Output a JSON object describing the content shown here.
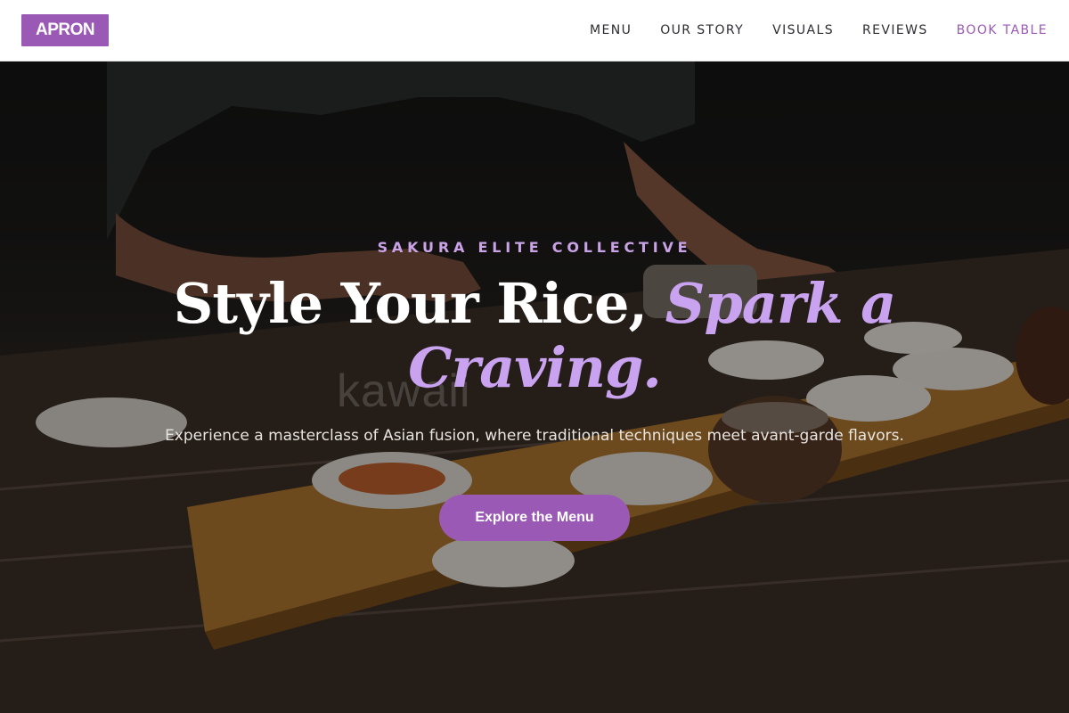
{
  "header": {
    "logo": "APRON",
    "nav": [
      {
        "label": "MENU"
      },
      {
        "label": "OUR STORY"
      },
      {
        "label": "VISUALS"
      },
      {
        "label": "REVIEWS"
      },
      {
        "label": "BOOK TABLE"
      }
    ]
  },
  "hero": {
    "eyebrow": "SAKURA ELITE COLLECTIVE",
    "headline_main": "Style Your Rice, ",
    "headline_accent": "Spark a Craving.",
    "subtitle": "Experience a masterclass of Asian fusion, where traditional techniques meet avant-garde flavors.",
    "cta_label": "Explore the Menu",
    "watermark": "kawaii"
  },
  "colors": {
    "brand": "#9b59b6",
    "accent_light": "#c9a3ef",
    "nav_text": "#2b2d33"
  }
}
